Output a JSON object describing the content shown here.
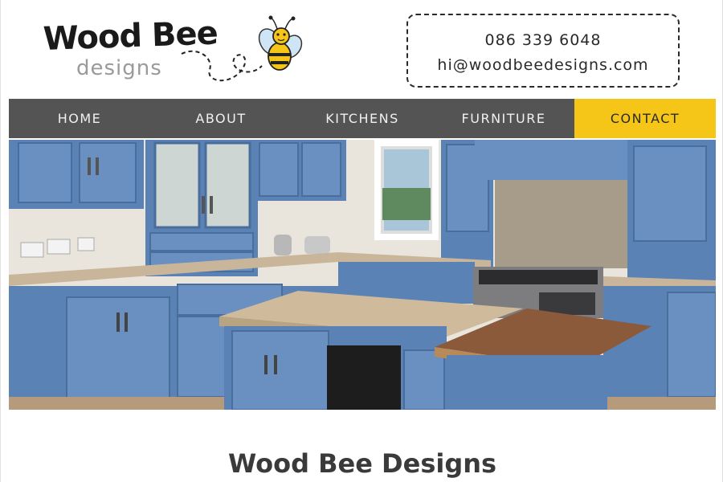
{
  "brand": {
    "logo_main": "Wood Bee",
    "logo_sub": "designs",
    "yellow": "#f5c518",
    "nav_bg": "#545454"
  },
  "contact": {
    "phone": "086 339 6048",
    "email": "hi@woodbeedesigns.com"
  },
  "nav": {
    "items": [
      {
        "label": "HOME"
      },
      {
        "label": "ABOUT"
      },
      {
        "label": "KITCHENS"
      },
      {
        "label": "FURNITURE"
      },
      {
        "label": "CONTACT",
        "active": true
      }
    ]
  },
  "hero": {
    "image": "kitchen-photo"
  },
  "main": {
    "title": "Wood Bee Designs"
  }
}
